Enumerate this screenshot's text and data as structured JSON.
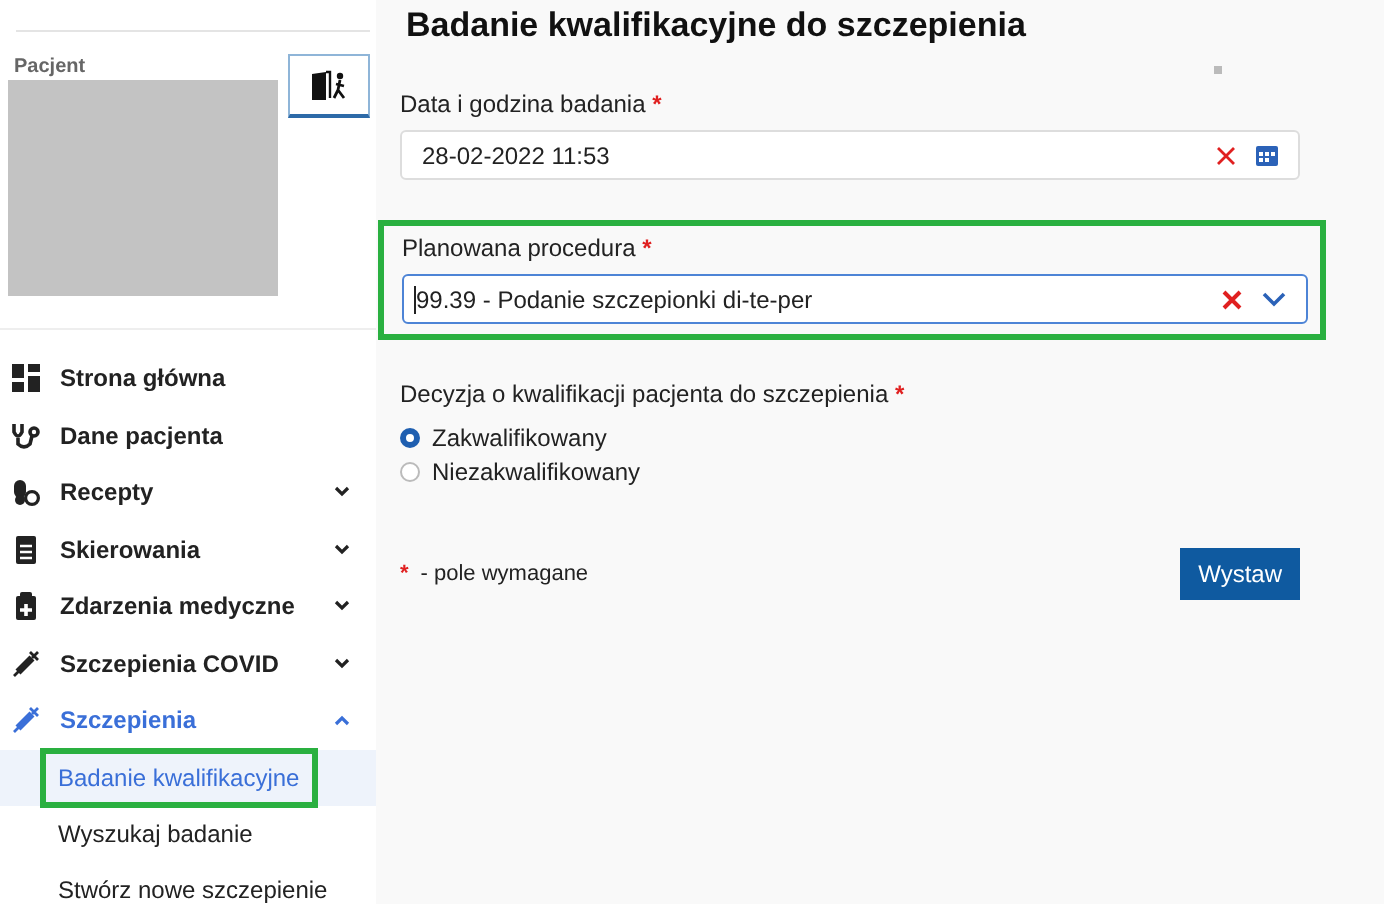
{
  "patient": {
    "label": "Pacjent"
  },
  "menu": [
    {
      "label": "Strona główna",
      "selected": false
    },
    {
      "label": "Dane pacjenta",
      "selected": false
    },
    {
      "label": "Recepty",
      "expanded": false,
      "selected": false
    },
    {
      "label": "Skierowania",
      "expanded": false,
      "selected": false
    },
    {
      "label": "Zdarzenia medyczne",
      "expanded": false,
      "selected": false
    },
    {
      "label": "Szczepienia COVID",
      "expanded": false,
      "selected": false
    },
    {
      "label": "Szczepienia",
      "expanded": true,
      "selected": true,
      "children": [
        {
          "label": "Badanie kwalifikacyjne",
          "selected": true,
          "highlighted": true
        },
        {
          "label": "Wyszukaj badanie",
          "selected": false,
          "highlighted": false
        },
        {
          "label": "Stwórz nowe szczepienie",
          "selected": false,
          "highlighted": false
        }
      ]
    }
  ],
  "page": {
    "title": "Badanie kwalifikacyjne do szczepienia"
  },
  "fields": [
    {
      "kind": "date",
      "label": "Data i godzina badania",
      "required_mark": "*",
      "value": "28-02-2022 11:53",
      "focused": false,
      "highlighted": false
    },
    {
      "kind": "select",
      "label": "Planowana procedura",
      "required_mark": "*",
      "value": "99.39 - Podanie szczepionki di-te-per",
      "focused": true,
      "highlighted": true
    }
  ],
  "decision": {
    "label": "Decyzja o kwalifikacji pacjenta do szczepienia",
    "required_mark": "*",
    "options": [
      {
        "label": "Zakwalifikowany",
        "selected": true
      },
      {
        "label": "Niezakwalifikowany",
        "selected": false
      }
    ]
  },
  "legend": {
    "mark": "*",
    "text": "- pole wymagane"
  },
  "submit": {
    "label": "Wystaw"
  }
}
